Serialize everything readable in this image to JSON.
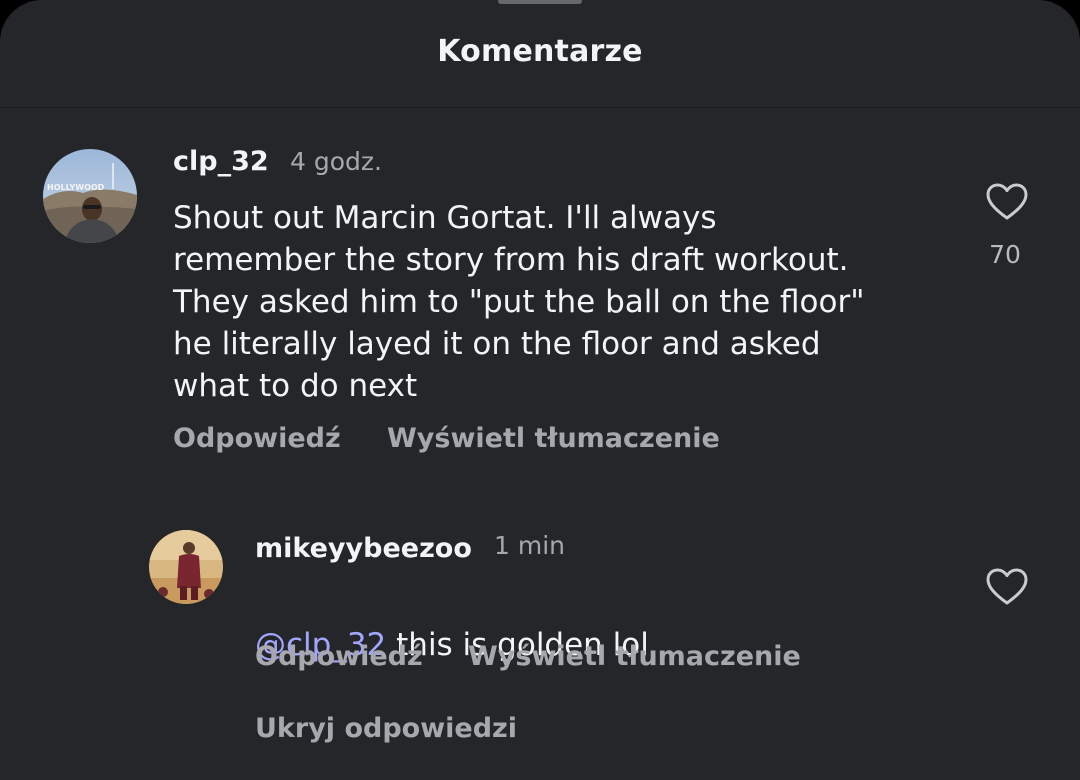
{
  "header": {
    "title": "Komentarze"
  },
  "comments": [
    {
      "username": "clp_32",
      "time": "4 godz.",
      "text": "Shout out Marcin Gortat. I'll always\nremember the story from his draft workout.\nThey asked him to \"put the ball on the floor\"\nhe literally layed it on the floor and asked\nwhat to do next",
      "likes": "70",
      "avatar_sign": "HOLLYWOOD",
      "reply_label": "Odpowiedź",
      "translate_label": "Wyświetl tłumaczenie"
    }
  ],
  "replies": [
    {
      "username": "mikeyybeezoo",
      "time": "1 min",
      "mention": "@clp_32",
      "text": " this is golden lol",
      "reply_label": "Odpowiedź",
      "translate_label": "Wyświetl tłumaczenie"
    }
  ],
  "hide_replies_label": "Ukryj odpowiedzi",
  "icons": {
    "like": "heart-outline-icon"
  },
  "colors": {
    "background": "#252629",
    "text": "#f3f4f6",
    "secondary": "#a6a8ad",
    "mention": "#a3a6ff"
  }
}
